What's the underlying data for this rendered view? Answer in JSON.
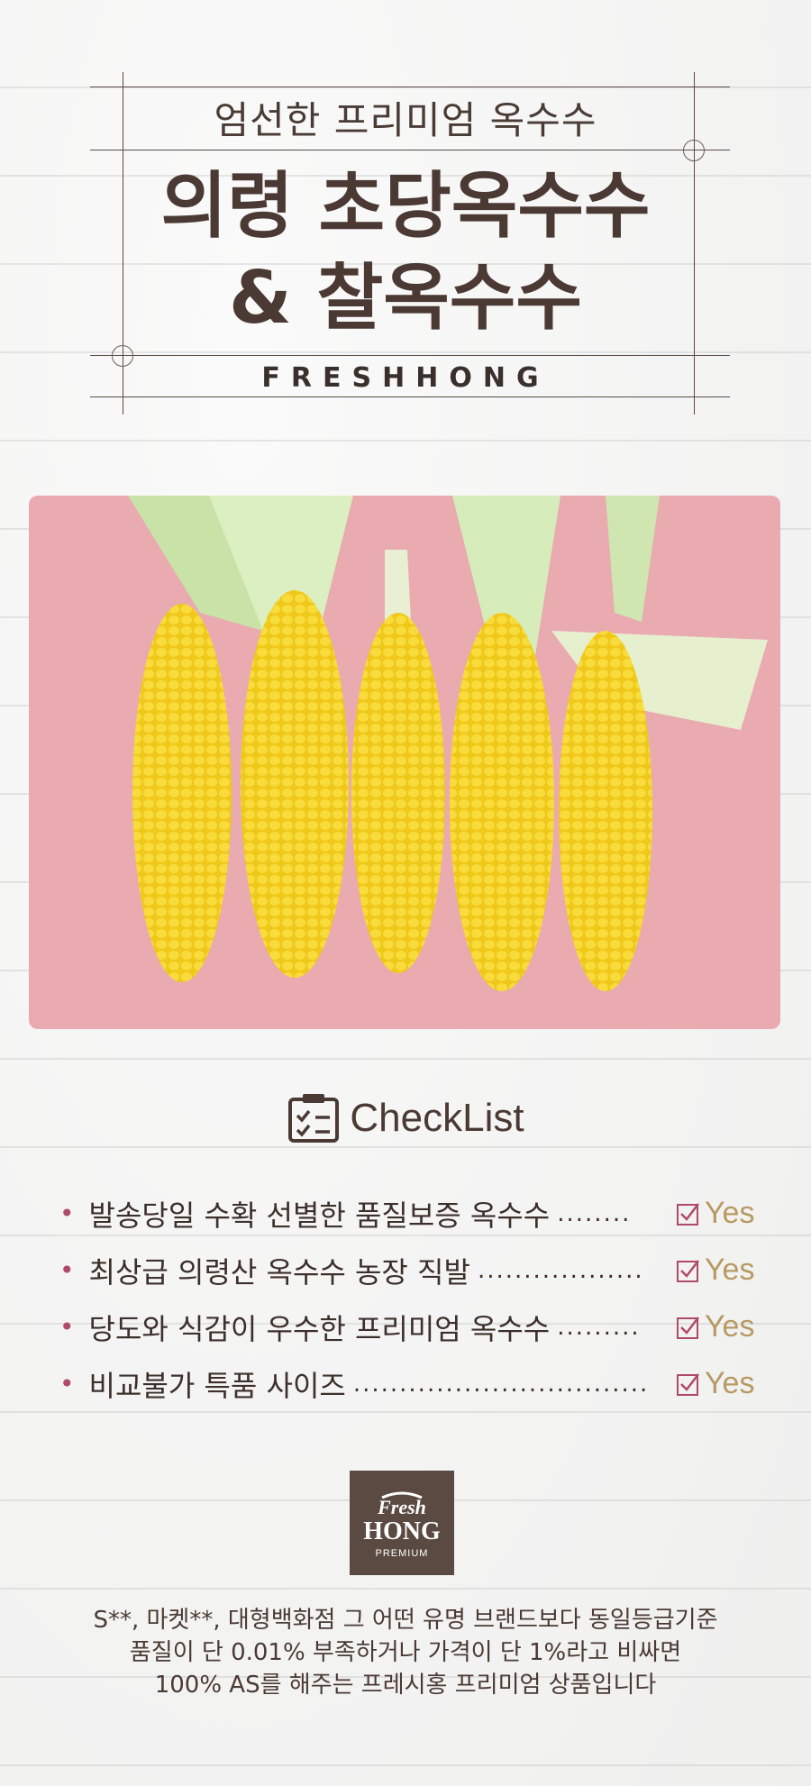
{
  "header": {
    "subtitle": "엄선한 프리미엄 옥수수",
    "title_line1": "의령 초당옥수수",
    "title_line2": "& 찰옥수수",
    "brand": "FRESHHONG"
  },
  "photo": {
    "background_color": "#e9aab0",
    "cob_color": "#f3d31e"
  },
  "checklist": {
    "heading": "CheckList",
    "items": [
      {
        "text": "발송당일 수확 선별한 품질보증 옥수수",
        "dots": "........",
        "answer": "Yes"
      },
      {
        "text": "최상급 의령산 옥수수 농장 직발",
        "dots": "..................",
        "answer": "Yes"
      },
      {
        "text": "당도와 식감이 우수한 프리미엄 옥수수",
        "dots": ".........",
        "answer": "Yes"
      },
      {
        "text": "비교불가 특품 사이즈",
        "dots": "................................",
        "answer": "Yes"
      }
    ]
  },
  "logo": {
    "line1": "Fresh",
    "line2": "HONG",
    "line3": "PREMIUM"
  },
  "footer": {
    "line1": "S**, 마켓**, 대형백화점 그 어떤 유명 브랜드보다 동일등급기준",
    "line2": "품질이 단 0.01% 부족하거나 가격이 단 1%라고 비싸면",
    "line3": "100% AS를 해주는 프레시홍 프리미엄 상품입니다"
  },
  "colors": {
    "text": "#4b3a33",
    "accent_check": "#b04a6a",
    "yes": "#b79a63"
  }
}
